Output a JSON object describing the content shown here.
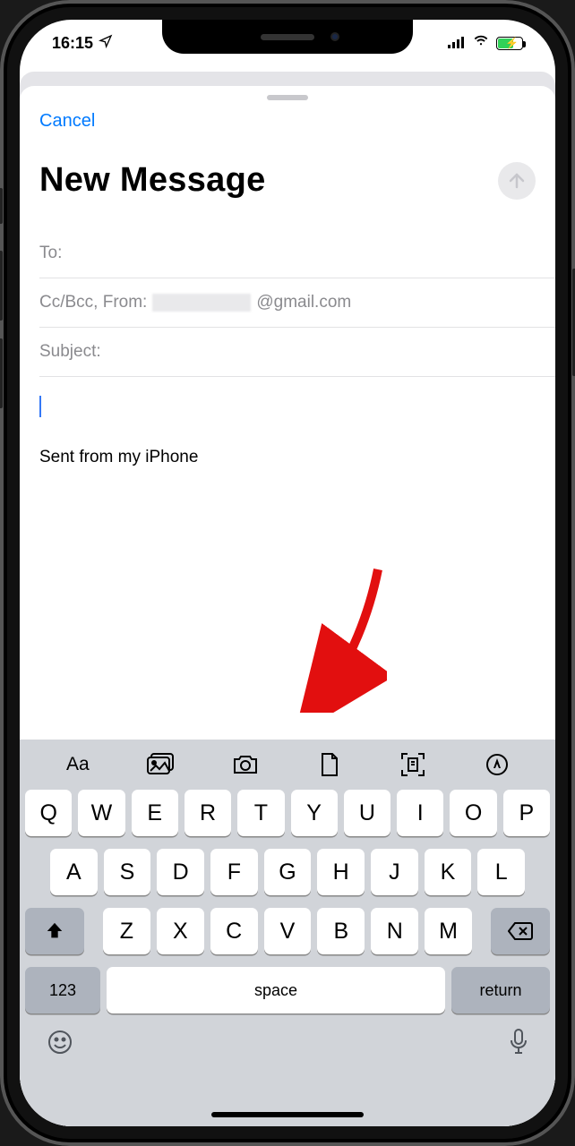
{
  "status": {
    "time": "16:15",
    "location_icon": "location-arrow"
  },
  "compose": {
    "cancel": "Cancel",
    "title": "New Message",
    "to_label": "To:",
    "cc_from_label": "Cc/Bcc, From:",
    "from_value_suffix": "@gmail.com",
    "subject_label": "Subject:",
    "signature": "Sent from my iPhone"
  },
  "keyboard": {
    "row1": [
      "Q",
      "W",
      "E",
      "R",
      "T",
      "Y",
      "U",
      "I",
      "O",
      "P"
    ],
    "row2": [
      "A",
      "S",
      "D",
      "F",
      "G",
      "H",
      "J",
      "K",
      "L"
    ],
    "row3": [
      "Z",
      "X",
      "C",
      "V",
      "B",
      "N",
      "M"
    ],
    "numkey": "123",
    "space": "space",
    "return": "return"
  }
}
